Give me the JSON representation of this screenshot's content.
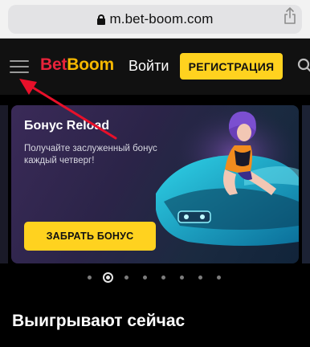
{
  "browser": {
    "url": "m.bet-boom.com",
    "lock_icon": "lock-icon",
    "share_icon": "share-icon"
  },
  "header": {
    "menu_icon": "hamburger-menu-icon",
    "logo": {
      "part1": "Bet",
      "part2": "Boom"
    },
    "login_label": "Войти",
    "register_label": "РЕГИСТРАЦИЯ",
    "search_icon": "search-icon"
  },
  "banner": {
    "title": "Бонус Reload",
    "subtitle": "Получайте заслуженный бонус каждый четверг!",
    "button_label": "ЗАБРАТЬ БОНУС"
  },
  "carousel": {
    "total": 8,
    "active_index": 1
  },
  "section": {
    "title": "Выигрывают сейчас"
  },
  "colors": {
    "accent_yellow": "#ffd21f",
    "logo_red": "#e8233a",
    "logo_yellow": "#f5b700",
    "annotation_arrow": "#e8102a"
  }
}
